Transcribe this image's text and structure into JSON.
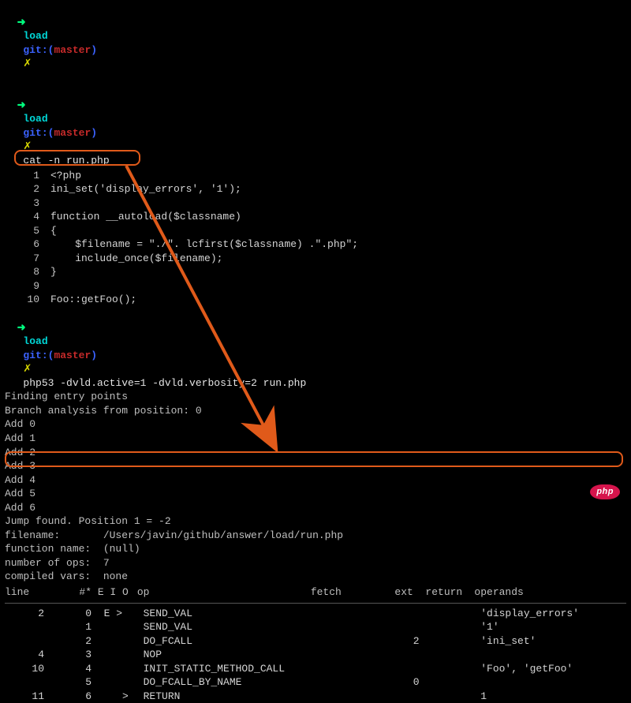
{
  "prompt": {
    "arrow": "➜",
    "load": "load",
    "git": "git:(",
    "branch": "master",
    "gitclose": ")",
    "x": "✗"
  },
  "commands": {
    "blank": "",
    "cat": "cat -n run.php",
    "php": "php53 -dvld.active=1 -dvld.verbosity=2 run.php"
  },
  "code": [
    {
      "n": "1",
      "t": "<?php"
    },
    {
      "n": "2",
      "t": "ini_set('display_errors', '1');"
    },
    {
      "n": "3",
      "t": ""
    },
    {
      "n": "4",
      "t": "function __autoload($classname)"
    },
    {
      "n": "5",
      "t": "{"
    },
    {
      "n": "6",
      "t": "    $filename = \"./\". lcfirst($classname) .\".php\";"
    },
    {
      "n": "7",
      "t": "    include_once($filename);"
    },
    {
      "n": "8",
      "t": "}"
    },
    {
      "n": "9",
      "t": ""
    },
    {
      "n": "10",
      "t": "Foo::getFoo();"
    }
  ],
  "analysis": {
    "lines": [
      "Finding entry points",
      "Branch analysis from position: 0",
      "Add 0",
      "Add 1",
      "Add 2",
      "Add 3",
      "Add 4",
      "Add 5",
      "Add 6",
      "Jump found. Position 1 = -2"
    ],
    "filename_label": "filename:",
    "filename": "/Users/javin/github/answer/load/run.php",
    "funcname_label": "function name:",
    "funcname": "(null)",
    "numops_label": "number of ops:",
    "numops": "7",
    "compvars_label": "compiled vars:",
    "compvars": "none"
  },
  "opcodes": {
    "header": {
      "line": "line",
      "num": "#*",
      "flags": "E I O",
      "op": "op",
      "fetch": "fetch",
      "ext": "ext",
      "ret": "return",
      "oper": "operands"
    },
    "rows": [
      {
        "line": "2",
        "num": "0",
        "flags": "E >  ",
        "op": "SEND_VAL",
        "fetch": "",
        "ext": "",
        "ret": "",
        "oper": "'display_errors'"
      },
      {
        "line": "",
        "num": "1",
        "flags": "     ",
        "op": "SEND_VAL",
        "fetch": "",
        "ext": "",
        "ret": "",
        "oper": "'1'"
      },
      {
        "line": "",
        "num": "2",
        "flags": "     ",
        "op": "DO_FCALL",
        "fetch": "",
        "ext": "2",
        "ret": "",
        "oper": "'ini_set'"
      },
      {
        "line": "4",
        "num": "3",
        "flags": "     ",
        "op": "NOP",
        "fetch": "",
        "ext": "",
        "ret": "",
        "oper": ""
      },
      {
        "line": "10",
        "num": "4",
        "flags": "     ",
        "op": "INIT_STATIC_METHOD_CALL",
        "fetch": "",
        "ext": "",
        "ret": "",
        "oper": "'Foo', 'getFoo'"
      },
      {
        "line": "",
        "num": "5",
        "flags": "     ",
        "op": "DO_FCALL_BY_NAME",
        "fetch": "",
        "ext": "0",
        "ret": "",
        "oper": ""
      },
      {
        "line": "11",
        "num": "6",
        "flags": "   > ",
        "op": "RETURN",
        "fetch": "",
        "ext": "",
        "ret": "",
        "oper": "1"
      }
    ]
  },
  "badge": "php"
}
